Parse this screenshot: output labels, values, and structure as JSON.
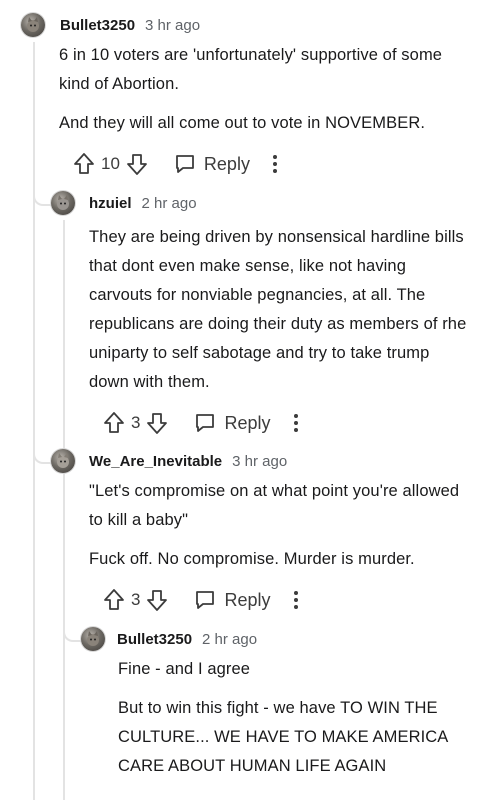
{
  "comments": [
    {
      "username": "Bullet3250",
      "time": "3 hr ago",
      "paragraphs": [
        "6 in 10 voters are 'unfortunately' supportive of some kind of Abortion.",
        "And they will all come out to vote in NOVEMBER."
      ],
      "votes": "10",
      "reply_label": "Reply"
    },
    {
      "username": "hzuiel",
      "time": "2 hr ago",
      "paragraphs": [
        "They are being driven by nonsensical hardline bills that dont even make sense, like not having carvouts for nonviable pegnancies, at all. The republicans are doing their duty as members of rhe uniparty to self sabotage and try to take trump down with them."
      ],
      "votes": "3",
      "reply_label": "Reply"
    },
    {
      "username": "We_Are_Inevitable",
      "time": "3 hr ago",
      "paragraphs": [
        "\"Let's compromise on at what point you're allowed to kill a baby\"",
        "Fuck off. No compromise. Murder is murder."
      ],
      "votes": "3",
      "reply_label": "Reply"
    },
    {
      "username": "Bullet3250",
      "time": "2 hr ago",
      "paragraphs": [
        "Fine - and I agree",
        "But to win this fight - we have TO WIN THE CULTURE... WE HAVE TO MAKE AMERICA CARE ABOUT HUMAN LIFE AGAIN"
      ]
    }
  ],
  "icons": {
    "upvote": "arrow-up-icon",
    "downvote": "arrow-down-icon",
    "reply": "comment-bubble-icon",
    "more": "more-vertical-icon"
  },
  "colors": {
    "text": "#1a1a1b",
    "meta": "#5f6368",
    "thread": "#e3e3e3"
  }
}
